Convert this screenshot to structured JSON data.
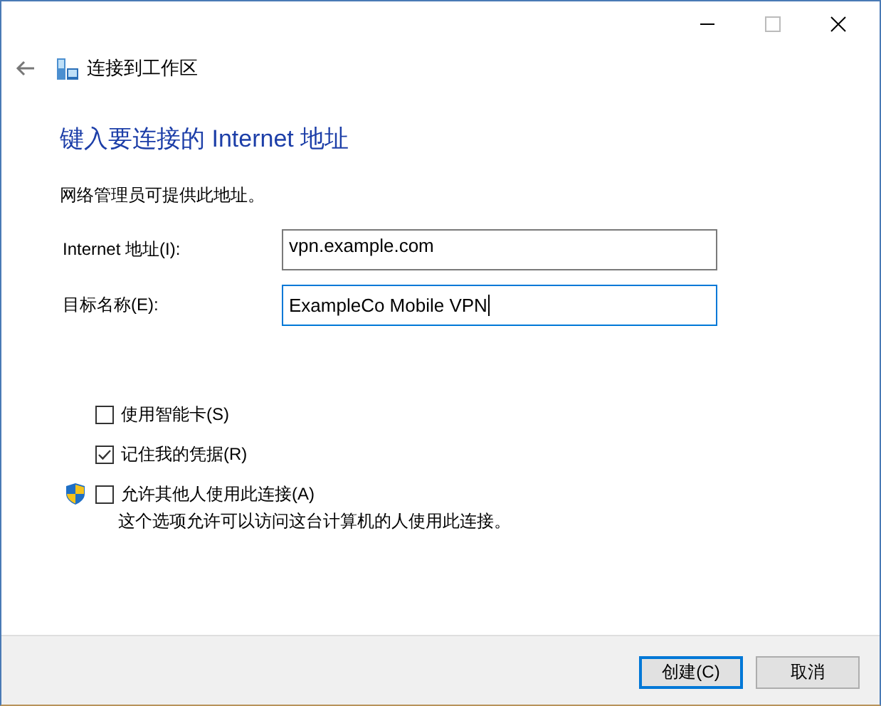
{
  "window": {
    "title": "连接到工作区"
  },
  "heading": "键入要连接的 Internet 地址",
  "intro": "网络管理员可提供此地址。",
  "fields": [
    {
      "label": "Internet 地址(I):",
      "value": "vpn.example.com",
      "focused": false
    },
    {
      "label": "目标名称(E):",
      "value": "ExampleCo Mobile VPN",
      "focused": true
    }
  ],
  "options": [
    {
      "kind": "plain",
      "label": "使用智能卡(S)",
      "checked": false
    },
    {
      "kind": "plain",
      "label": "记住我的凭据(R)",
      "checked": true
    },
    {
      "kind": "admin",
      "label": "允许其他人使用此连接(A)",
      "checked": false,
      "description": "这个选项允许可以访问这台计算机的人使用此连接。"
    }
  ],
  "buttons": [
    {
      "label": "创建(C)",
      "default": true
    },
    {
      "label": "取消",
      "default": false
    }
  ]
}
